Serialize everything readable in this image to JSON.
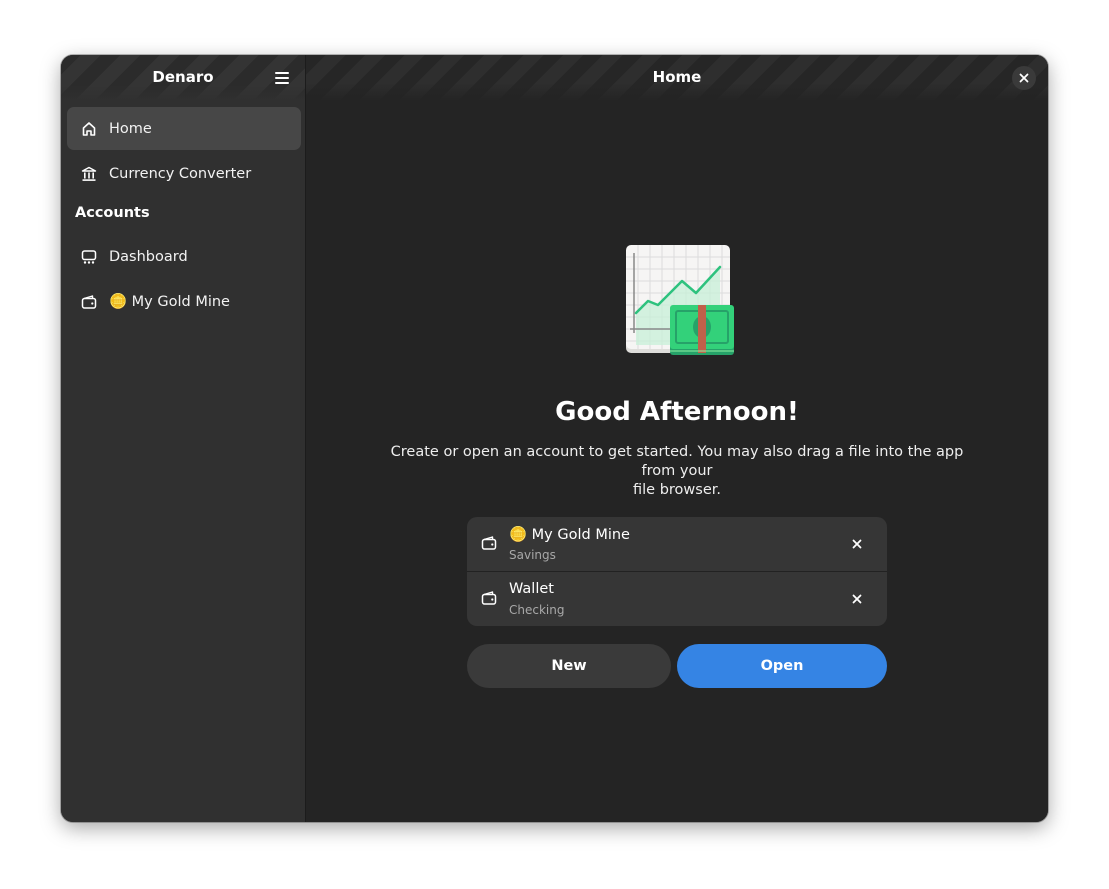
{
  "app": {
    "title": "Denaro"
  },
  "sidebar": {
    "items": [
      {
        "label": "Home",
        "icon": "home-icon",
        "active": true
      },
      {
        "label": "Currency Converter",
        "icon": "bank-icon",
        "active": false
      }
    ],
    "section_title": "Accounts",
    "account_items": [
      {
        "label": "Dashboard",
        "icon": "dashboard-icon"
      },
      {
        "label": "🪙 My Gold Mine",
        "icon": "wallet-icon"
      }
    ]
  },
  "header": {
    "title": "Home"
  },
  "main": {
    "greeting": "Good Afternoon!",
    "description_line1": "Create or open an account to get started. You may also drag a file into the app from your",
    "description_line2": "file browser.",
    "recent_accounts": [
      {
        "title": "🪙 My Gold Mine",
        "subtitle": "Savings",
        "icon": "wallet-icon"
      },
      {
        "title": "Wallet",
        "subtitle": "Checking",
        "icon": "wallet-icon"
      }
    ],
    "new_label": "New",
    "open_label": "Open"
  },
  "colors": {
    "accent": "#3584e4",
    "sidebar_bg": "#303030",
    "content_bg": "#242424",
    "illustration_green": "#33d17a"
  }
}
